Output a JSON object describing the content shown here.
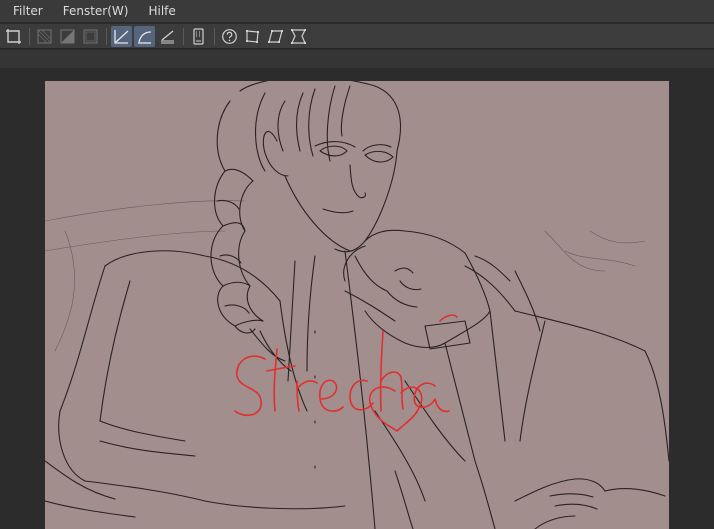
{
  "menu": {
    "items": [
      {
        "label": "Filter"
      },
      {
        "label": "Fenster(W)"
      },
      {
        "label": "Hilfe"
      }
    ]
  },
  "toolbar": {
    "tools": [
      {
        "icon": "crop-icon",
        "state": "normal"
      },
      {
        "icon": "fill-transparent-icon",
        "state": "disabled"
      },
      {
        "icon": "fill-gradient-icon",
        "state": "disabled"
      },
      {
        "icon": "fill-square-icon",
        "state": "disabled"
      },
      {
        "icon": "ruler-straight-icon",
        "state": "active"
      },
      {
        "icon": "ruler-curve-icon",
        "state": "active"
      },
      {
        "icon": "ruler-angle-icon",
        "state": "normal"
      },
      {
        "icon": "device-icon",
        "state": "normal"
      },
      {
        "icon": "help-circle-icon",
        "state": "normal"
      },
      {
        "icon": "transform-free-icon",
        "state": "normal"
      },
      {
        "icon": "transform-skew-icon",
        "state": "normal"
      },
      {
        "icon": "transform-perspective-icon",
        "state": "normal"
      }
    ]
  },
  "canvas": {
    "background": "#a38e8e",
    "line_color": "#2a2222",
    "signature_color": "#e0302e",
    "signature_text": "Strecha"
  },
  "colors": {
    "menubar": "#3a3a3a",
    "toolbar": "#3c3c3c",
    "active_tool": "#56657e",
    "workspace": "#2c2c2c"
  }
}
